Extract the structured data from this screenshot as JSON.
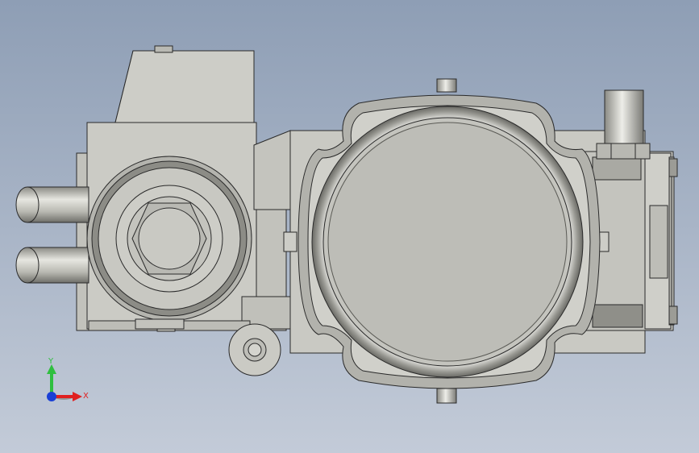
{
  "viewport": {
    "background_top": "#8e9eb5",
    "background_bottom": "#c3cbd8",
    "part_color": "#c9c9c3",
    "edge_color": "#2a2a2a"
  },
  "triad": {
    "y_label": "Y",
    "x_label": "X",
    "y_color": "#2fbf3f",
    "x_color": "#e02020",
    "z_color": "#1a3fd6"
  }
}
